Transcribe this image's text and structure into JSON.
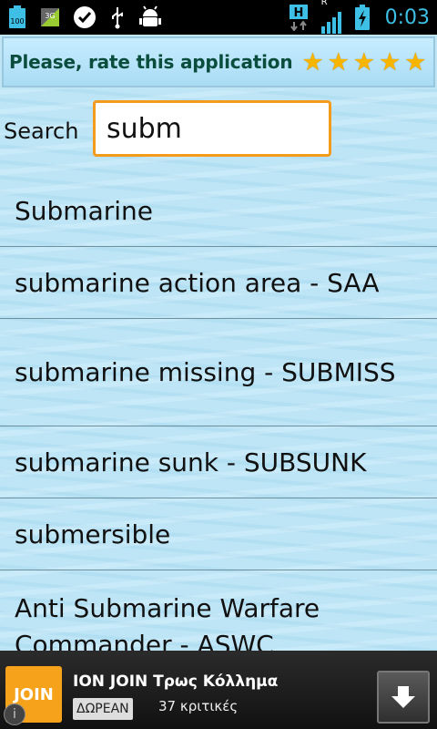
{
  "status_bar": {
    "battery_level": "100",
    "network_type": "3G",
    "signal_badge": "H",
    "roaming_badge": "R",
    "time": "0:03"
  },
  "rate_banner": {
    "text": "Please, rate this application",
    "stars": 5
  },
  "search": {
    "label": "Search",
    "value": "subm"
  },
  "results": [
    "Submarine",
    "submarine action area - SAA",
    "submarine missing - SUBMISS",
    "submarine sunk - SUBSUNK",
    "submersible",
    "Anti Submarine Warfare Commander - ASWC"
  ],
  "ad": {
    "logo_text": "JOIN",
    "title": "ION JOIN Τρως Κόλλημα",
    "price": "ΔΩΡΕΑΝ",
    "reviews": "37 κριτικές"
  },
  "colors": {
    "accent": "#3ec0e6",
    "search_border": "#f59b1b",
    "star": "#f7b500",
    "ad_logo": "#f6a21b"
  }
}
